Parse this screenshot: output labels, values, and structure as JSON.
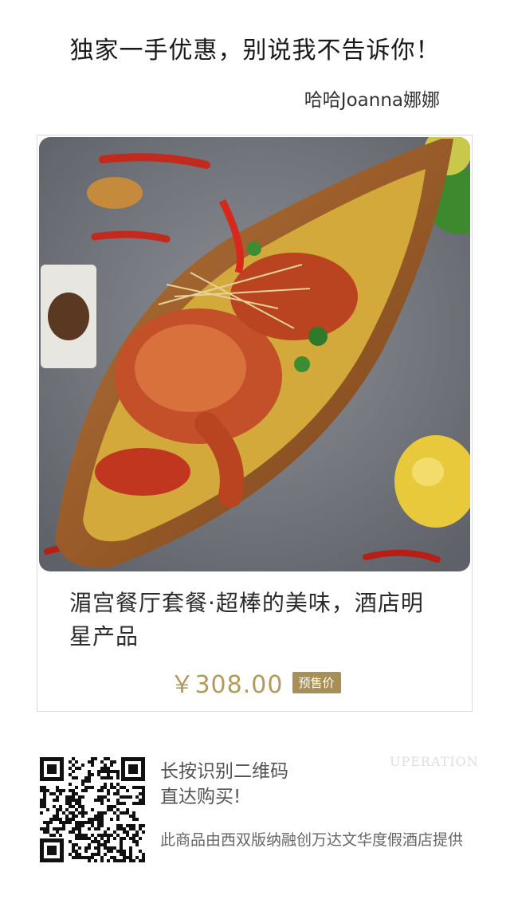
{
  "header": {
    "headline": "独家一手优惠，别说我不告诉你！",
    "author": "哈哈Joanna娜娜"
  },
  "product": {
    "image_label": "咖喱蟹菜品图",
    "title": "湄宫餐厅套餐·超棒的美味，酒店明星产品",
    "price": "￥308.00",
    "badge": "预售价"
  },
  "footer": {
    "scan_line_1": "长按识别二维码",
    "scan_line_2": "直达购买!",
    "note": "此商品由西双版纳融创万达文华度假酒店提供",
    "watermark": "UPERATION"
  },
  "colors": {
    "accent_gold": "#b29a5b",
    "badge_bg": "#a88f56"
  }
}
